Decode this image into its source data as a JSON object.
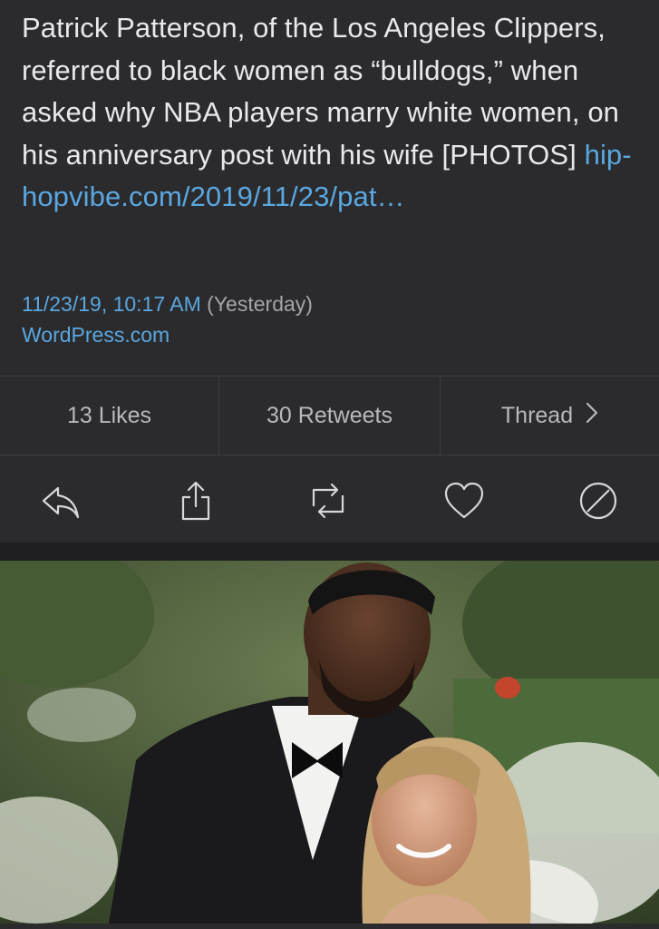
{
  "tweet": {
    "text": "Patrick Patterson, of the Los Angeles Clippers, referred to black women as “bulldogs,” when asked why NBA players marry white women, on his anniversary post with his wife [PHOTOS] ",
    "link": "hip-hopvibe.com/2019/11/23/pat…",
    "timestamp": "11/23/19, 10:17 AM",
    "relative": "(Yesterday)",
    "source": "WordPress.com"
  },
  "stats": {
    "likes": "13 Likes",
    "retweets": "30 Retweets",
    "thread": "Thread"
  },
  "actions": {
    "icons": [
      "reply-icon",
      "share-icon",
      "retweet-icon",
      "like-icon",
      "block-icon"
    ]
  },
  "colors": {
    "background": "#2b2b2d",
    "link": "#5aa7e0",
    "text": "#e9e9eb",
    "muted": "#b9b9bd"
  },
  "media": {
    "kind": "photo"
  }
}
